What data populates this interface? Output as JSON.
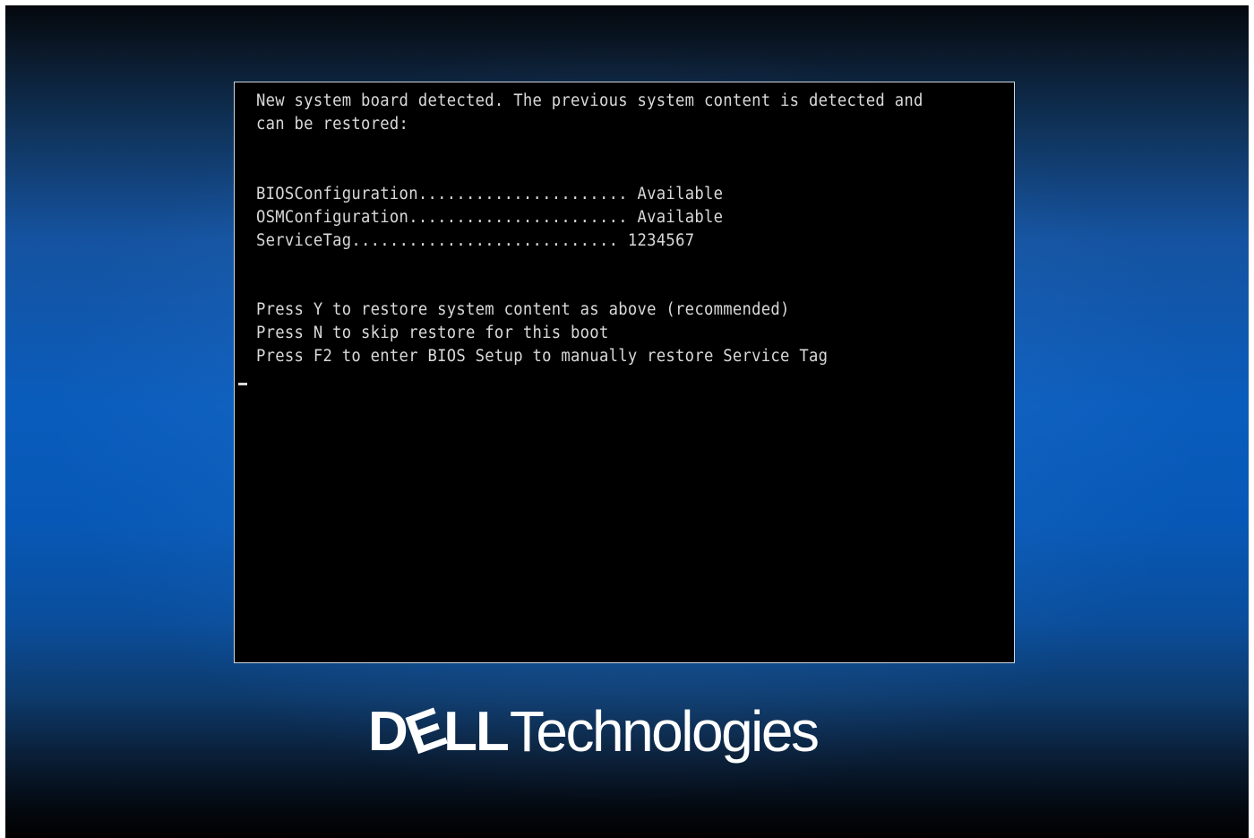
{
  "console": {
    "intro_line_1": "New system board detected. The previous system content is detected and",
    "intro_line_2": "can be restored:",
    "items": [
      {
        "label": "BIOSConfiguration",
        "dots": "......................",
        "value": "Available"
      },
      {
        "label": "OSMConfiguration",
        "dots": ".......................",
        "value": "Available"
      },
      {
        "label": "ServiceTag",
        "dots": "............................",
        "value": "1234567"
      }
    ],
    "options": [
      "Press Y to restore system content as above (recommended)",
      "Press N to skip restore for this boot",
      "Press F2 to enter BIOS Setup to manually restore Service Tag"
    ]
  },
  "brand": {
    "dell_d": "D",
    "dell_e": "E",
    "dell_ll": "LL",
    "technologies": "Technologies"
  },
  "colors": {
    "console_bg": "#000000",
    "console_text": "#d9d9d9",
    "background_blue": "#0a5cbc",
    "logo": "#ffffff"
  }
}
